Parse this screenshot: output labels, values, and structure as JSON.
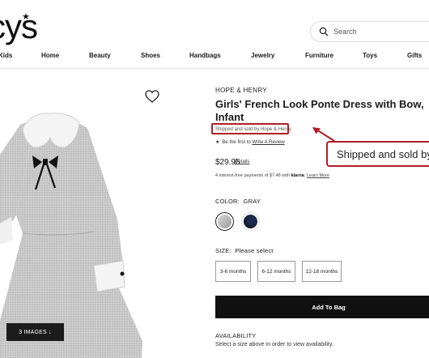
{
  "header": {
    "logo_text": "cys",
    "search_placeholder": "Search",
    "nav": [
      "Kids",
      "Home",
      "Beauty",
      "Shoes",
      "Handbags",
      "Jewelry",
      "Furniture",
      "Toys",
      "Gifts"
    ]
  },
  "gallery": {
    "images_button_label": "3 IMAGES ↓"
  },
  "product": {
    "brand": "HOPE & HENRY",
    "title": "Girls' French Look Ponte Dress with Bow, Infant",
    "sold_by": "Shipped and sold by Hope & Henry",
    "review_star": "★",
    "review_prefix": "Be the first to",
    "review_link": "Write A Review",
    "price": "$29.95",
    "details_link": "Details",
    "klarna_prefix": "4 interest-free payments of $7.48 with",
    "klarna_brand": "klarna",
    "klarna_link": "Learn More",
    "color_heading": "COLOR:",
    "color_value": "GRAY",
    "size_heading": "SIZE:",
    "size_value": "Please select",
    "sizes": [
      "3-6 months",
      "6-12 months",
      "12-18 months"
    ],
    "add_to_bag": "Add To Bag",
    "availability_heading": "AVAILABILITY",
    "availability_text": "Select a size above in order to view availability."
  },
  "annotation": {
    "callout_text": "Shipped and sold by Hope & Henry",
    "color": "#b01e28"
  },
  "icons": {
    "search": "search-icon",
    "wishlist": "heart-icon",
    "star": "star-icon"
  }
}
